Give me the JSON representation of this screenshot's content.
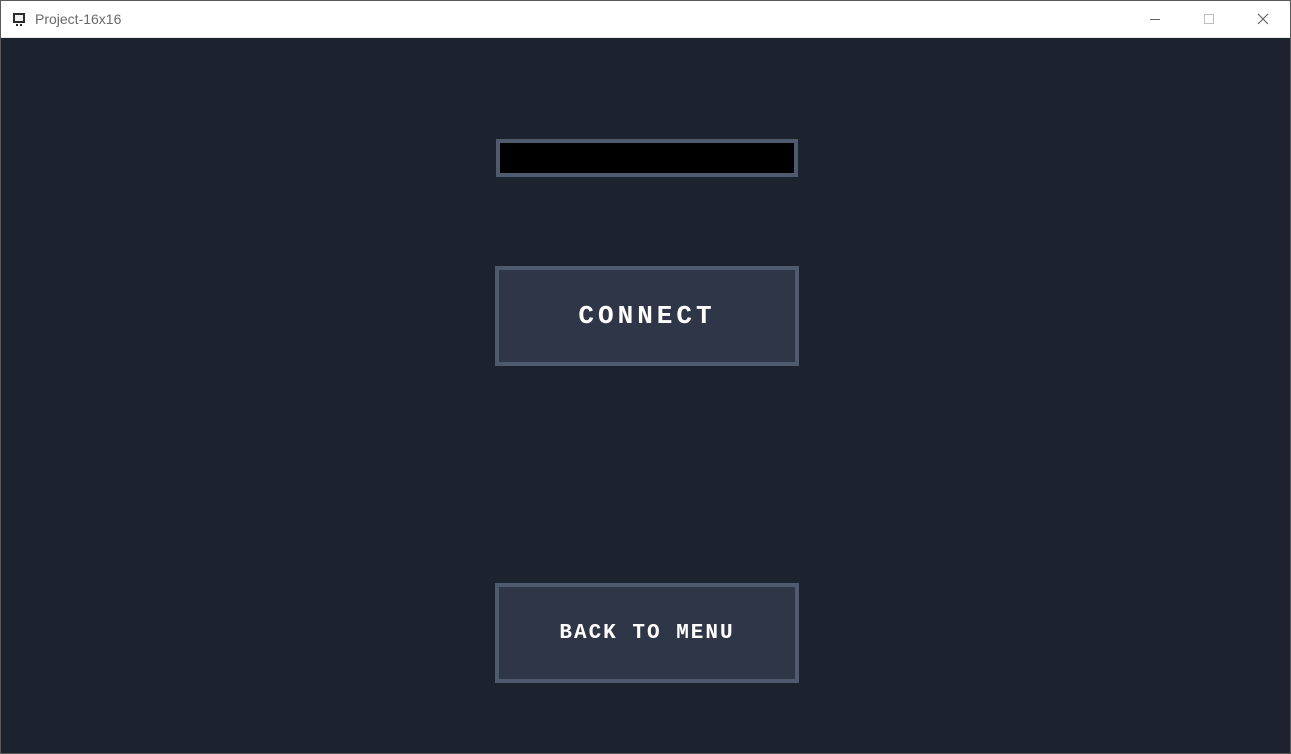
{
  "window": {
    "title": "Project-16x16"
  },
  "screen": {
    "address_value": "",
    "connect_label": "CONNECT",
    "back_label": "BACK TO MENU"
  },
  "colors": {
    "client_bg": "#1d222f",
    "panel_fill": "#2f3647",
    "panel_border": "#505a6e",
    "input_bg": "#000000",
    "text": "#ffffff"
  }
}
